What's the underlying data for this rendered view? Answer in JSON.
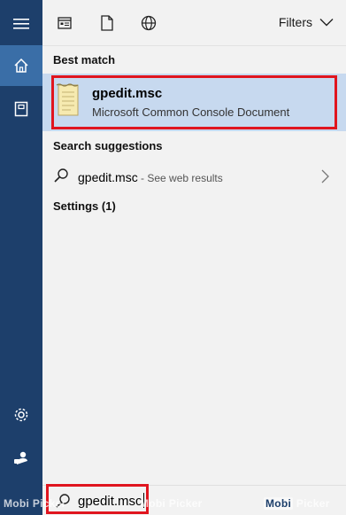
{
  "toolbar": {
    "filters_label": "Filters",
    "icons": [
      "apps-icon",
      "document-icon",
      "globe-icon"
    ]
  },
  "rail": {
    "icons": [
      "hamburger-icon",
      "home-icon",
      "notebook-icon",
      "gear-icon",
      "feedback-icon"
    ]
  },
  "best_match": {
    "heading": "Best match",
    "title": "gpedit.msc",
    "subtitle": "Microsoft Common Console Document"
  },
  "suggestions": {
    "heading": "Search suggestions",
    "query": "gpedit.msc",
    "suffix": " - See web results"
  },
  "settings": {
    "heading": "Settings (1)"
  },
  "search": {
    "value": "gpedit.msc"
  },
  "watermark": {
    "left": "Mobi Picker",
    "center": "Mobi Picker",
    "right_box": "Mobi",
    "right": "Picker"
  },
  "colors": {
    "rail": "#1d3f6b",
    "rail_active": "#3a6ea7",
    "selected_bg": "#c7d9ef",
    "annotation": "#e0151f"
  }
}
